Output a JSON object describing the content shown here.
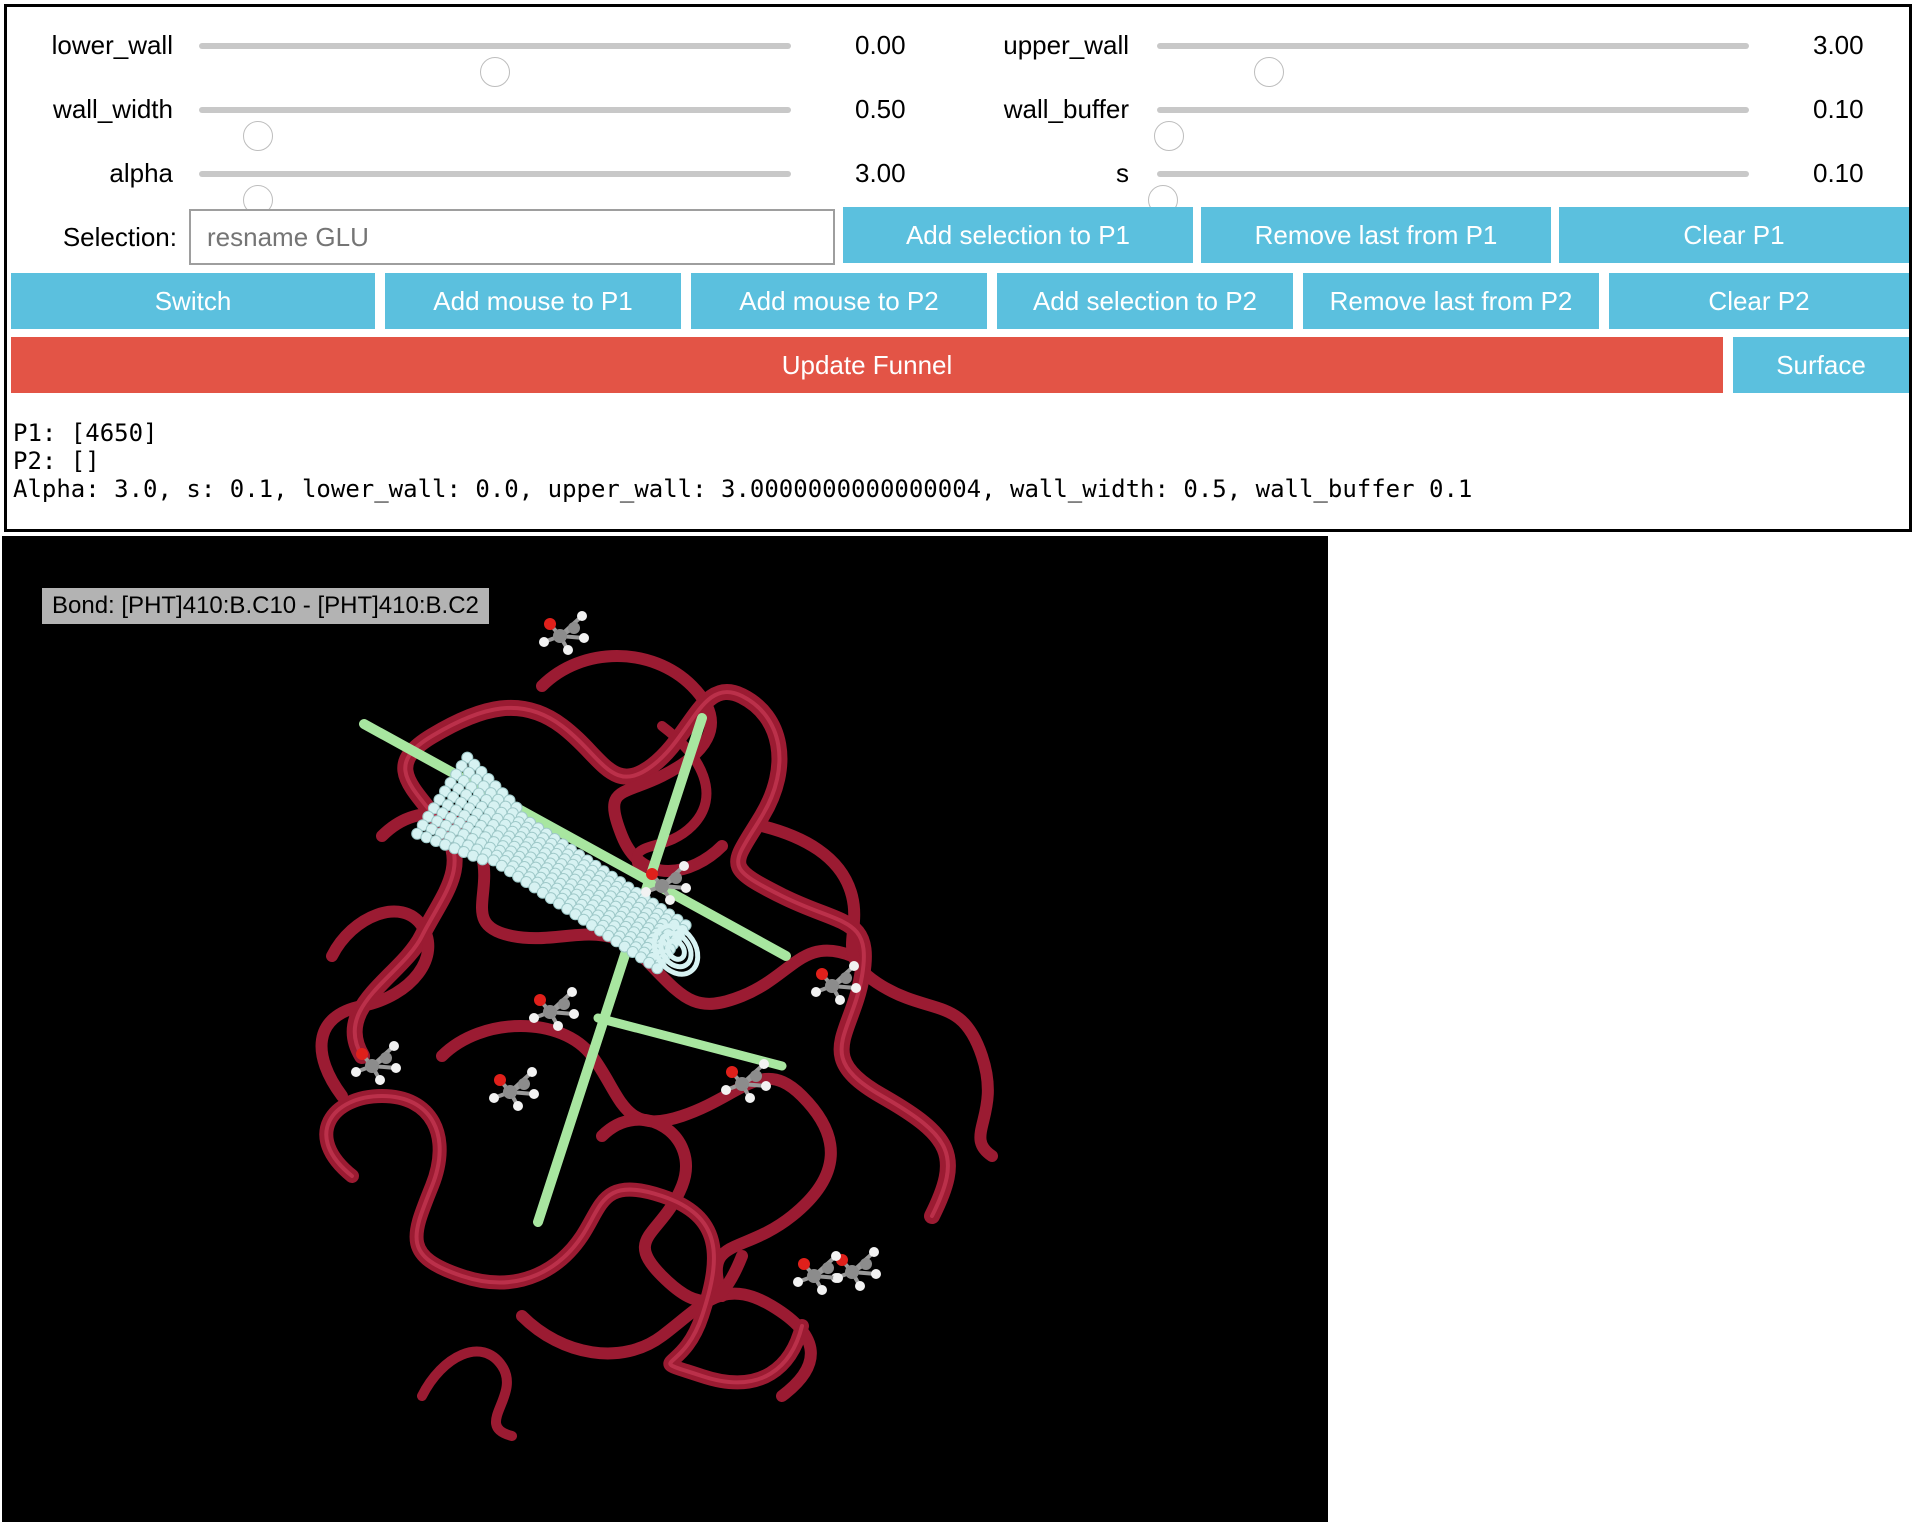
{
  "sliders": {
    "lower_wall": {
      "label": "lower_wall",
      "value": "0.00",
      "position": 0.5
    },
    "upper_wall": {
      "label": "upper_wall",
      "value": "3.00",
      "position": 0.19
    },
    "wall_width": {
      "label": "wall_width",
      "value": "0.50",
      "position": 0.1
    },
    "wall_buffer": {
      "label": "wall_buffer",
      "value": "0.10",
      "position": 0.02
    },
    "alpha": {
      "label": "alpha",
      "value": "3.00",
      "position": 0.1
    },
    "s": {
      "label": "s",
      "value": "0.10",
      "position": 0.01
    }
  },
  "selection": {
    "label": "Selection:",
    "placeholder": "resname GLU"
  },
  "buttons": {
    "add_selection_p1": "Add selection to P1",
    "remove_last_p1": "Remove last from P1",
    "clear_p1": "Clear P1",
    "switch": "Switch",
    "add_mouse_p1": "Add mouse to P1",
    "add_mouse_p2": "Add mouse to P2",
    "add_selection_p2": "Add selection to P2",
    "remove_last_p2": "Remove last from P2",
    "clear_p2": "Clear P2",
    "update_funnel": "Update Funnel",
    "surface": "Surface"
  },
  "output": {
    "p1": "P1: [4650]",
    "p2": "P2: []",
    "params": "Alpha: 3.0, s: 0.1, lower_wall: 0.0, upper_wall: 3.0000000000000004, wall_width: 0.5, wall_buffer 0.1"
  },
  "viewer": {
    "hover_label": "Bond: [PHT]410:B.C10 - [PHT]410:B.C2",
    "colors": {
      "background": "#000000",
      "protein_ribbon": "#9b1b32",
      "funnel_axis": "#a8e6a0",
      "funnel_spheres": "#d7f2f2",
      "carbon": "#8c8c8c",
      "oxygen": "#e0201b",
      "hydrogen": "#f2f2f2"
    }
  },
  "colors": {
    "button": "#5bc0de",
    "button_danger": "#e35446",
    "button_text": "#ffffff"
  }
}
